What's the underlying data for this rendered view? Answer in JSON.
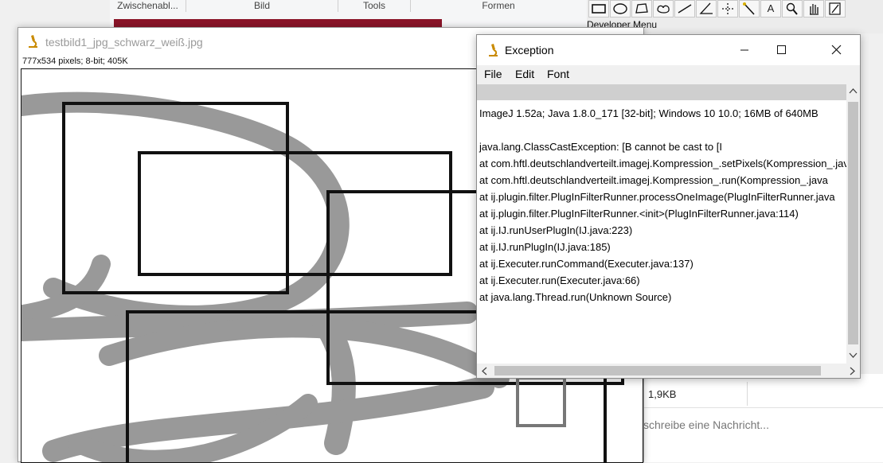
{
  "paint": {
    "groups": [
      "Zwischenabl...",
      "Bild",
      "Tools",
      "Formen"
    ]
  },
  "imagej_toolbar": {
    "tools": [
      "rectangle-tool-icon",
      "oval-tool-icon",
      "polygon-tool-icon",
      "freehand-tool-icon",
      "line-tool-icon",
      "angle-tool-icon",
      "point-tool-icon",
      "wand-tool-icon",
      "text-tool-icon",
      "magnifier-tool-icon",
      "hand-tool-icon",
      "dropper-tool-icon"
    ],
    "text_tool_glyph": "A",
    "developer_menu": "Developer Menu"
  },
  "image_window": {
    "title": "testbild1_jpg_schwarz_weiß.jpg",
    "info": "777x534 pixels; 8-bit; 405K"
  },
  "exception_window": {
    "title": "Exception",
    "menu": [
      "File",
      "Edit",
      "Font"
    ],
    "lines": [
      "ImageJ 1.52a; Java 1.8.0_171 [32-bit]; Windows 10 10.0; 16MB of 640MB",
      "",
      "java.lang.ClassCastException: [B cannot be cast to [I",
      "at com.hftl.deutschlandverteilt.imagej.Kompression_.setPixels(Kompression_.java",
      "at com.hftl.deutschlandverteilt.imagej.Kompression_.run(Kompression_.java",
      "at ij.plugin.filter.PlugInFilterRunner.processOneImage(PlugInFilterRunner.java",
      "at ij.plugin.filter.PlugInFilterRunner.<init>(PlugInFilterRunner.java:114)",
      "at ij.IJ.runUserPlugIn(IJ.java:223)",
      "at ij.IJ.runPlugIn(IJ.java:185)",
      "at ij.Executer.runCommand(Executer.java:137)",
      "at ij.Executer.run(Executer.java:66)",
      "at java.lang.Thread.run(Unknown Source)"
    ]
  },
  "chat": {
    "size_label": "1,9KB",
    "input_placeholder": "schreibe eine Nachricht..."
  },
  "colors": {
    "paint_red": "#8a1428",
    "stroke_gray": "#999999"
  }
}
